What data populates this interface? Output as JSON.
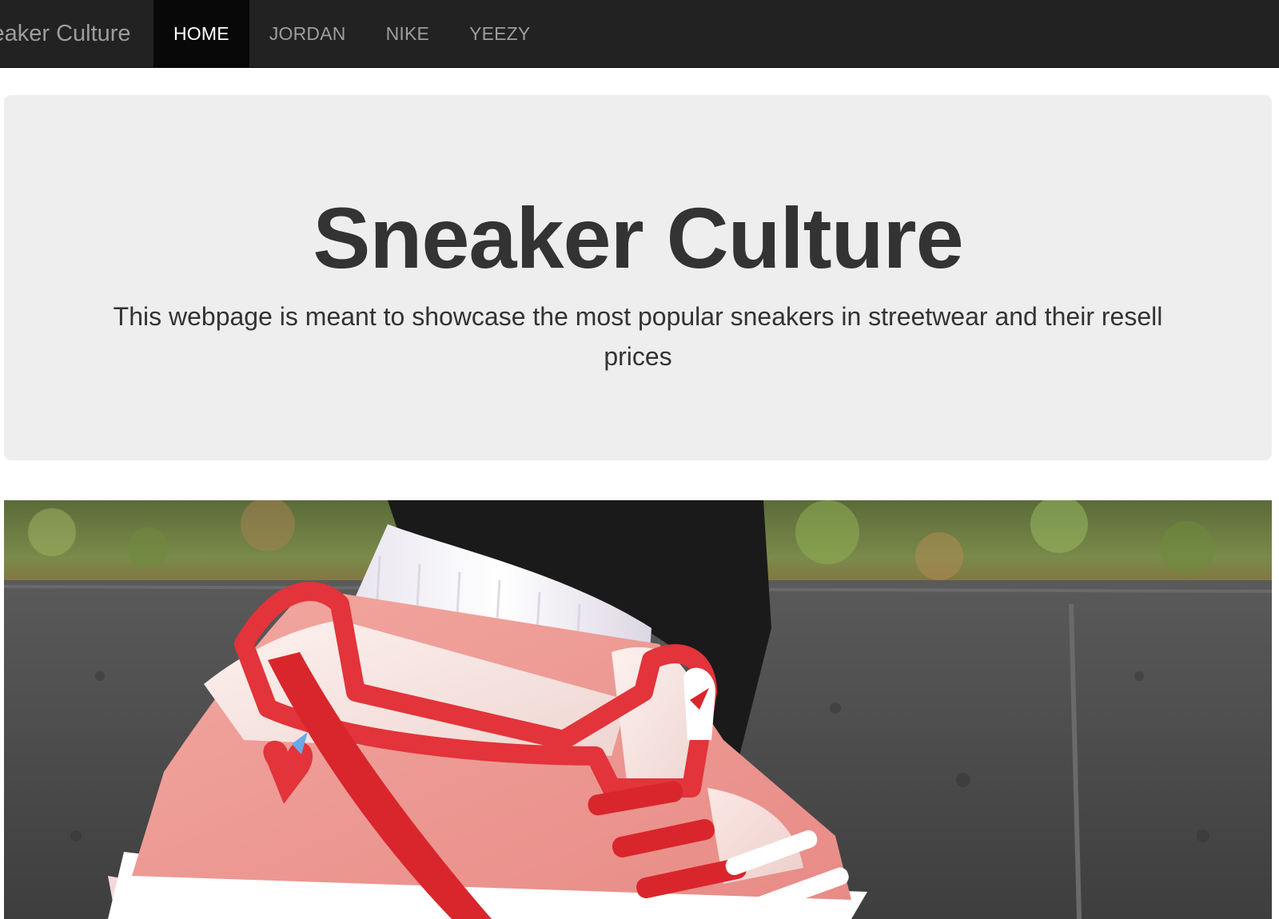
{
  "navbar": {
    "brand": "Sneaker Culture",
    "items": [
      {
        "label": "HOME",
        "active": true
      },
      {
        "label": "JORDAN",
        "active": false
      },
      {
        "label": "NIKE",
        "active": false
      },
      {
        "label": "YEEZY",
        "active": false
      }
    ]
  },
  "jumbotron": {
    "title": "Sneaker Culture",
    "text": "This webpage is meant to showcase the most popular sneakers in streetwear and their resell prices"
  },
  "hero": {
    "icon": "sneaker-photo"
  },
  "colors": {
    "navbar_bg": "#222222",
    "nav_active_bg": "#080808",
    "nav_text": "#9d9d9d",
    "jumbotron_bg": "#eeeeee",
    "title_text": "#333333"
  }
}
